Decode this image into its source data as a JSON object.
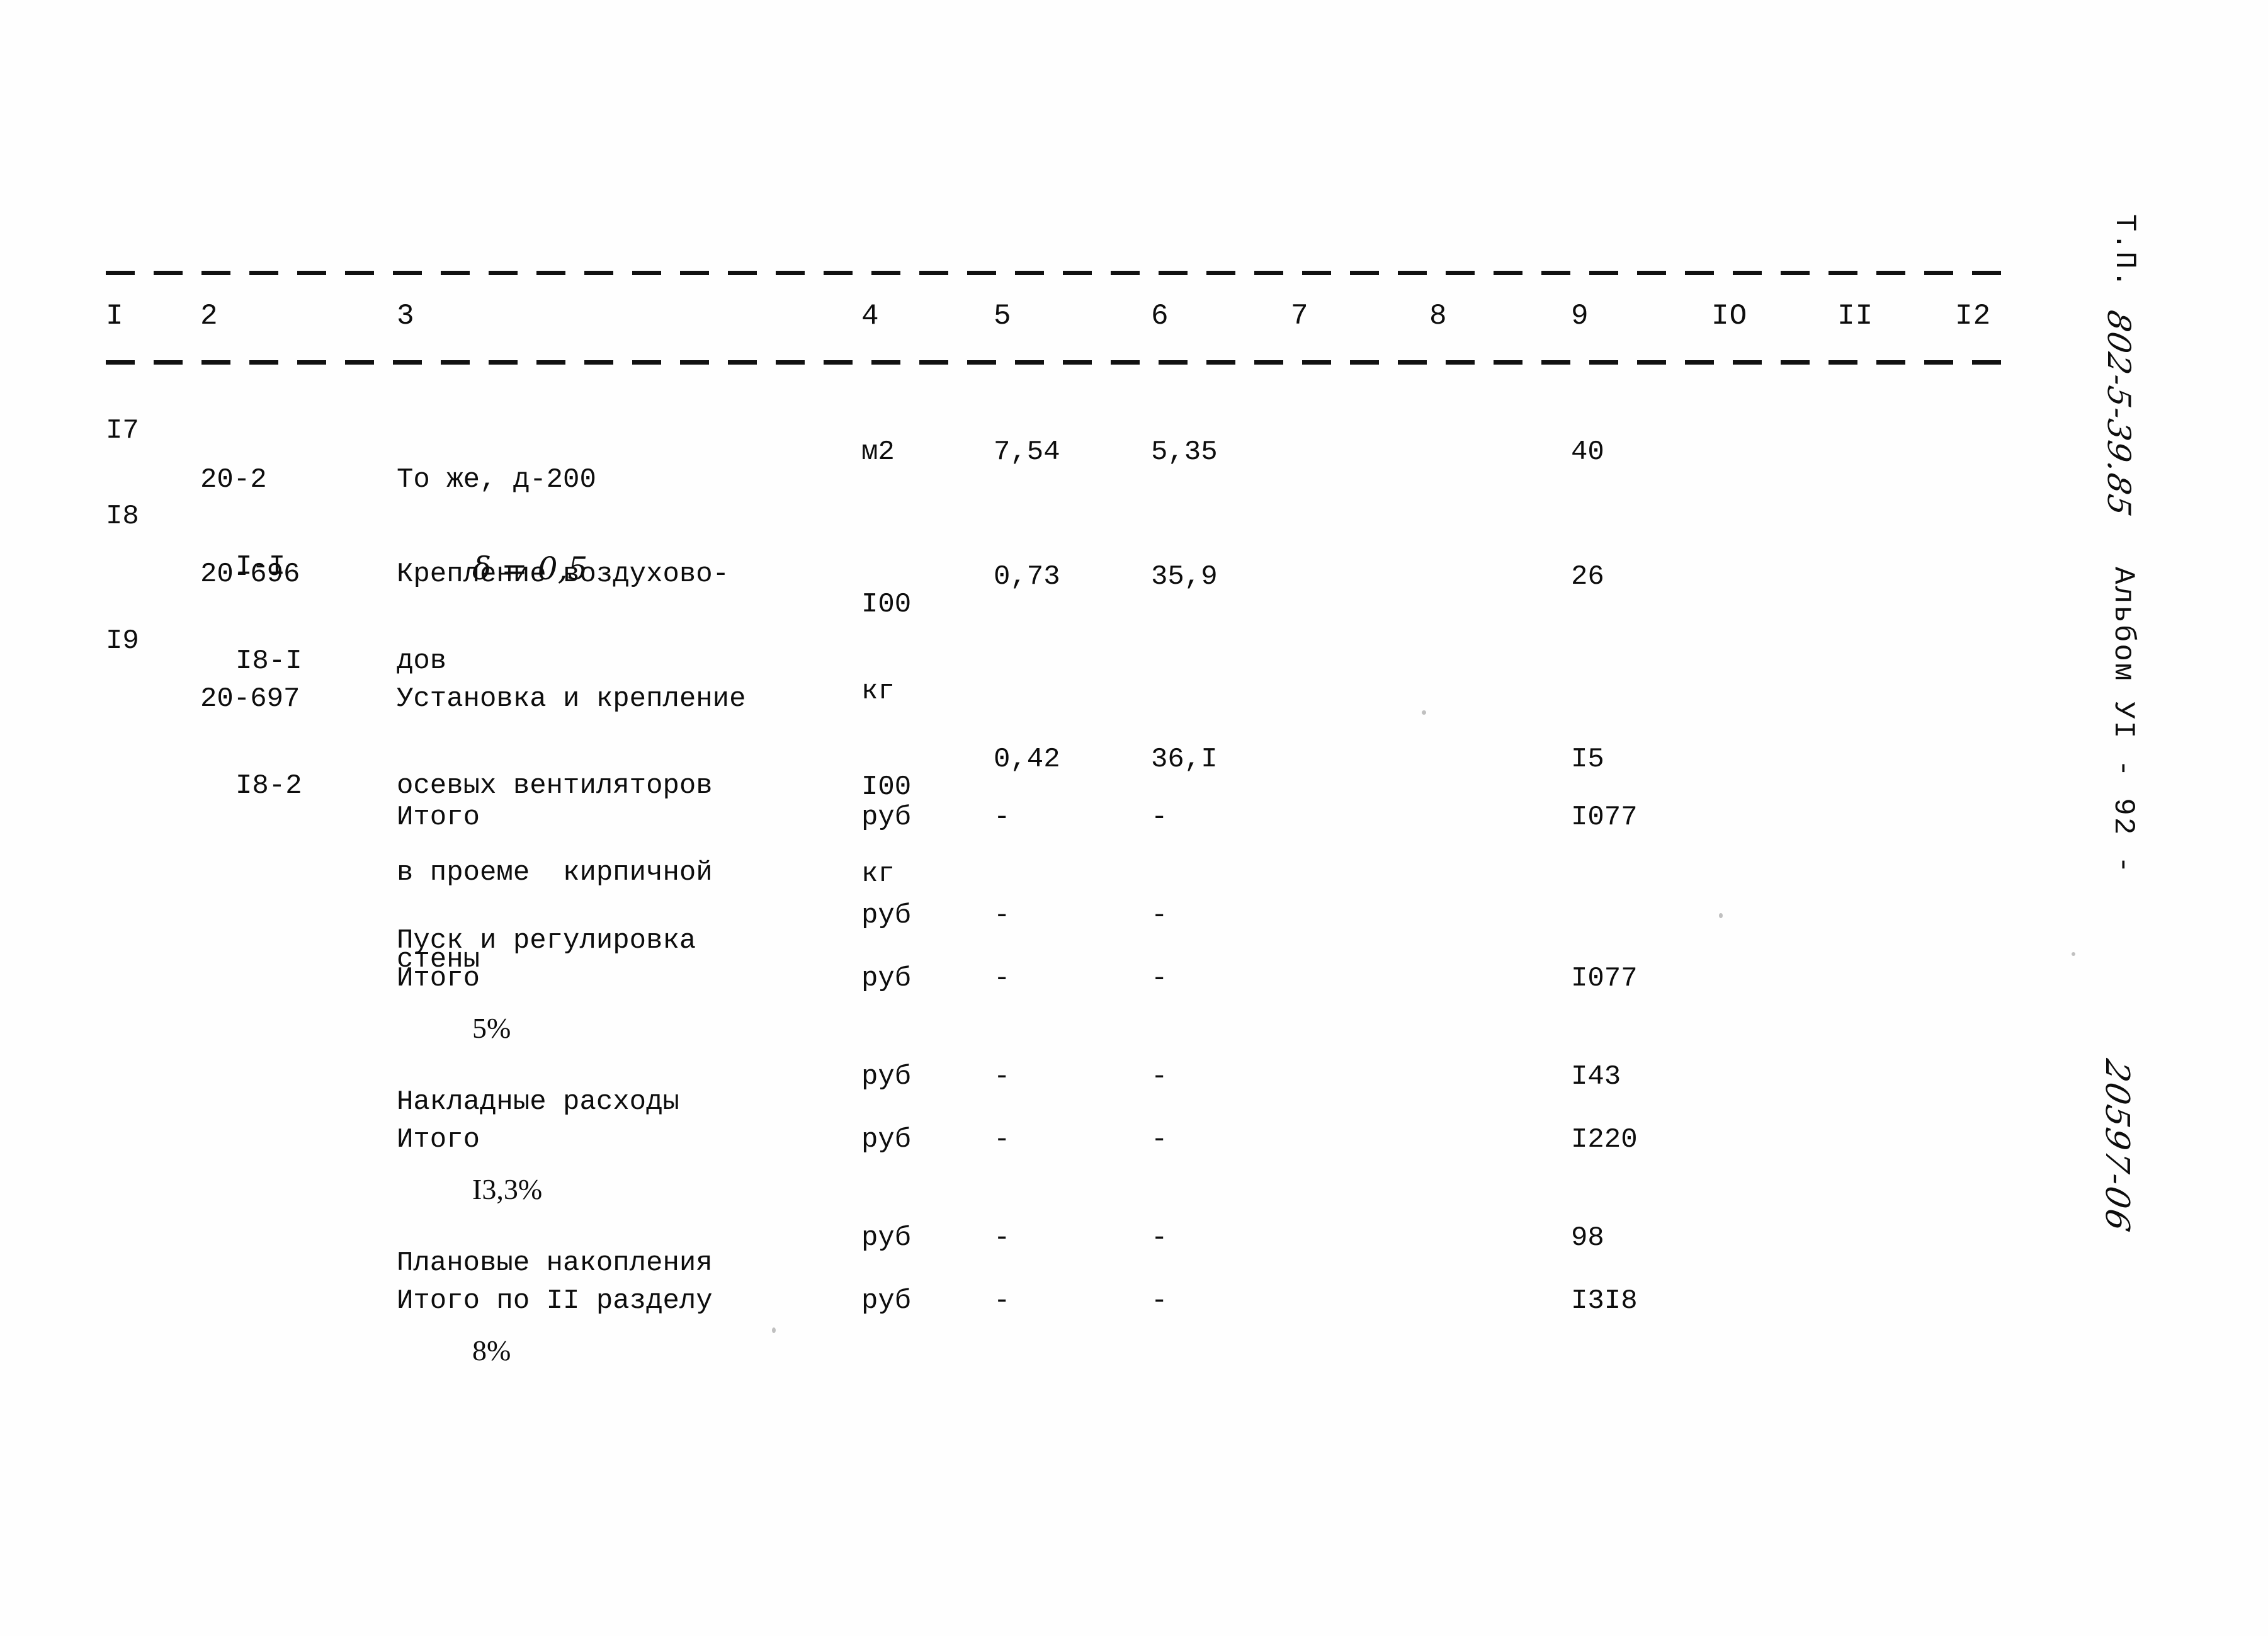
{
  "document": {
    "kind": "scanned-soviet-estimate-table",
    "margin_vertical": {
      "project_label": "Т.П.",
      "project_code": "802-5-39.85",
      "album": "Альбом УI   -   92   -",
      "archive_code": "20597-06"
    }
  },
  "table": {
    "column_numbers": [
      "I",
      "2",
      "3",
      "4",
      "5",
      "6",
      "7",
      "8",
      "9",
      "IO",
      "II",
      "I2"
    ],
    "rows": [
      {
        "no": "I7",
        "code_line1": "20-2",
        "code_line2": "I-I",
        "desc_line1": "То же, д-200",
        "desc_line2": "δ = 0,5",
        "unit_line1": "",
        "unit_line2": "м2",
        "col5": "7,54",
        "col6": "5,35",
        "col7": "",
        "col8": "",
        "col9": "40",
        "col10": "",
        "col11": "",
        "col12": ""
      },
      {
        "no": "I8",
        "code_line1": "20-696",
        "code_line2": "I8-I",
        "desc_line1": "Крепление воздухово-",
        "desc_line2": "дов",
        "unit_line1": "I00",
        "unit_line2": "кг",
        "col5": "0,73",
        "col6": "35,9",
        "col7": "",
        "col8": "",
        "col9": "26",
        "col10": "",
        "col11": "",
        "col12": ""
      },
      {
        "no": "I9",
        "code_line1": "20-697",
        "code_line2": "I8-2",
        "desc_line1": "Установка и крепление",
        "desc_line2": "осевых вентиляторов",
        "desc_line3": "в проеме  кирпичной",
        "desc_line4": "стены",
        "unit_line1": "I00",
        "unit_line2": "кг",
        "col5": "0,42",
        "col6": "36,I",
        "col7": "",
        "col8": "",
        "col9": "I5",
        "col10": "",
        "col11": "",
        "col12": ""
      }
    ],
    "summary_rows": [
      {
        "label": "Итого",
        "label2": "",
        "unit": "руб",
        "col5": "-",
        "col6": "-",
        "col9": "I077"
      },
      {
        "label": "Пуск и регулировка",
        "label2": "5%",
        "unit": "руб",
        "col5": "-",
        "col6": "-",
        "col9": ""
      },
      {
        "label": "Итого",
        "label2": "",
        "unit": "руб",
        "col5": "-",
        "col6": "-",
        "col9": "I077"
      },
      {
        "label": "Накладные расходы",
        "label2": "I3,3%",
        "unit": "руб",
        "col5": "-",
        "col6": "-",
        "col9": "I43"
      },
      {
        "label": "Итого",
        "label2": "",
        "unit": "руб",
        "col5": "-",
        "col6": "-",
        "col9": "I220"
      },
      {
        "label": "Плановые накопления",
        "label2": "8%",
        "unit": "руб",
        "col5": "-",
        "col6": "-",
        "col9": "98"
      },
      {
        "label": "Итого по II разделу",
        "label2": "",
        "unit": "руб",
        "col5": "-",
        "col6": "-",
        "col9": "I3I8"
      }
    ]
  }
}
